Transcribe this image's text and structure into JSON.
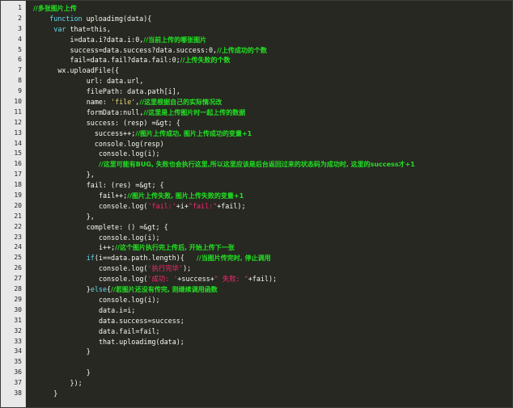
{
  "lines": [
    {
      "n": "1",
      "ind": 0,
      "segs": [
        {
          "t": "//多张图片上传",
          "c": "comment"
        }
      ]
    },
    {
      "n": "2",
      "ind": 4,
      "segs": [
        {
          "t": "function",
          "c": "kw"
        },
        {
          "t": " uploadimg(data){",
          "c": ""
        }
      ]
    },
    {
      "n": "3",
      "ind": 5,
      "segs": [
        {
          "t": "var",
          "c": "kw"
        },
        {
          "t": " that=this,",
          "c": ""
        }
      ]
    },
    {
      "n": "4",
      "ind": 9,
      "segs": [
        {
          "t": "i=data.i?data.i:0,",
          "c": ""
        },
        {
          "t": "//当前上传的哪张图片",
          "c": "comment"
        }
      ]
    },
    {
      "n": "5",
      "ind": 9,
      "segs": [
        {
          "t": "success=data.success?data.success:0,",
          "c": ""
        },
        {
          "t": "//上传成功的个数",
          "c": "comment"
        }
      ]
    },
    {
      "n": "6",
      "ind": 9,
      "segs": [
        {
          "t": "fail=data.fail?data.fail:0;",
          "c": ""
        },
        {
          "t": "//上传失败的个数",
          "c": "comment"
        }
      ]
    },
    {
      "n": "7",
      "ind": 6,
      "segs": [
        {
          "t": "wx.uploadFile({",
          "c": ""
        }
      ]
    },
    {
      "n": "8",
      "ind": 13,
      "segs": [
        {
          "t": "url: data.url,",
          "c": ""
        }
      ]
    },
    {
      "n": "9",
      "ind": 13,
      "segs": [
        {
          "t": "filePath: data.path[i],",
          "c": ""
        }
      ]
    },
    {
      "n": "10",
      "ind": 13,
      "segs": [
        {
          "t": "name: ",
          "c": ""
        },
        {
          "t": "'file'",
          "c": "str"
        },
        {
          "t": ",",
          "c": ""
        },
        {
          "t": "//这里根据自己的实际情况改",
          "c": "comment"
        }
      ]
    },
    {
      "n": "11",
      "ind": 13,
      "segs": [
        {
          "t": "formData:null,",
          "c": ""
        },
        {
          "t": "//这里是上传图片时一起上传的数据",
          "c": "comment"
        }
      ]
    },
    {
      "n": "12",
      "ind": 13,
      "segs": [
        {
          "t": "success: (resp) =&gt; {",
          "c": ""
        }
      ]
    },
    {
      "n": "13",
      "ind": 15,
      "segs": [
        {
          "t": "success++;",
          "c": ""
        },
        {
          "t": "//图片上传成功, 图片上传成功的变量+1",
          "c": "comment"
        }
      ]
    },
    {
      "n": "14",
      "ind": 15,
      "segs": [
        {
          "t": "console.log(resp)",
          "c": ""
        }
      ]
    },
    {
      "n": "15",
      "ind": 16,
      "segs": [
        {
          "t": "console.log(i);",
          "c": ""
        }
      ]
    },
    {
      "n": "16",
      "ind": 16,
      "segs": [
        {
          "t": "//这里可能有BUG, 失败也会执行这里,所以这里应该是后台返回过来的状态码为成功时, 这里的success才+1",
          "c": "comment"
        }
      ]
    },
    {
      "n": "17",
      "ind": 13,
      "segs": [
        {
          "t": "},",
          "c": ""
        }
      ]
    },
    {
      "n": "18",
      "ind": 13,
      "segs": [
        {
          "t": "fail: (res) =&gt; {",
          "c": ""
        }
      ]
    },
    {
      "n": "19",
      "ind": 16,
      "segs": [
        {
          "t": "fail++;",
          "c": ""
        },
        {
          "t": "//图片上传失败, 图片上传失败的变量+1",
          "c": "comment"
        }
      ]
    },
    {
      "n": "20",
      "ind": 16,
      "segs": [
        {
          "t": "console.log(",
          "c": ""
        },
        {
          "t": "'fail:'",
          "c": "red"
        },
        {
          "t": "+i+",
          "c": ""
        },
        {
          "t": "\"fail:\"",
          "c": "red"
        },
        {
          "t": "+fail);",
          "c": ""
        }
      ]
    },
    {
      "n": "21",
      "ind": 13,
      "segs": [
        {
          "t": "},",
          "c": ""
        }
      ]
    },
    {
      "n": "22",
      "ind": 13,
      "segs": [
        {
          "t": "complete: () =&gt; {",
          "c": ""
        }
      ]
    },
    {
      "n": "23",
      "ind": 16,
      "segs": [
        {
          "t": "console.log(i);",
          "c": ""
        }
      ]
    },
    {
      "n": "24",
      "ind": 16,
      "segs": [
        {
          "t": "i++;",
          "c": ""
        },
        {
          "t": "//这个图片执行完上传后, 开始上传下一张",
          "c": "comment"
        }
      ]
    },
    {
      "n": "25",
      "ind": 13,
      "segs": [
        {
          "t": "if",
          "c": "kw"
        },
        {
          "t": "(i==data.path.length){   ",
          "c": ""
        },
        {
          "t": "//当图片传完时, 停止调用",
          "c": "comment"
        }
      ]
    },
    {
      "n": "26",
      "ind": 16,
      "segs": [
        {
          "t": "console.log(",
          "c": ""
        },
        {
          "t": "'执行完毕'",
          "c": "red"
        },
        {
          "t": ");",
          "c": ""
        }
      ]
    },
    {
      "n": "27",
      "ind": 16,
      "segs": [
        {
          "t": "console.log(",
          "c": ""
        },
        {
          "t": "'成功: '",
          "c": "red"
        },
        {
          "t": "+success+",
          "c": ""
        },
        {
          "t": "\" 失败: \"",
          "c": "red"
        },
        {
          "t": "+fail);",
          "c": ""
        }
      ]
    },
    {
      "n": "28",
      "ind": 13,
      "segs": [
        {
          "t": "}",
          "c": ""
        },
        {
          "t": "else",
          "c": "kw"
        },
        {
          "t": "{",
          "c": ""
        },
        {
          "t": "//若图片还没有传完, 则继续调用函数",
          "c": "comment"
        }
      ]
    },
    {
      "n": "29",
      "ind": 16,
      "segs": [
        {
          "t": "console.log(i);",
          "c": ""
        }
      ]
    },
    {
      "n": "30",
      "ind": 16,
      "segs": [
        {
          "t": "data.i=i;",
          "c": ""
        }
      ]
    },
    {
      "n": "31",
      "ind": 16,
      "segs": [
        {
          "t": "data.success=success;",
          "c": ""
        }
      ]
    },
    {
      "n": "32",
      "ind": 16,
      "segs": [
        {
          "t": "data.fail=fail;",
          "c": ""
        }
      ]
    },
    {
      "n": "33",
      "ind": 16,
      "segs": [
        {
          "t": "that.uploadimg(data);",
          "c": ""
        }
      ]
    },
    {
      "n": "34",
      "ind": 13,
      "segs": [
        {
          "t": "}",
          "c": ""
        }
      ]
    },
    {
      "n": "35",
      "ind": 0,
      "segs": []
    },
    {
      "n": "36",
      "ind": 13,
      "segs": [
        {
          "t": "}",
          "c": ""
        }
      ]
    },
    {
      "n": "37",
      "ind": 9,
      "segs": [
        {
          "t": "});",
          "c": ""
        }
      ]
    },
    {
      "n": "38",
      "ind": 5,
      "segs": [
        {
          "t": "}",
          "c": ""
        }
      ]
    }
  ]
}
